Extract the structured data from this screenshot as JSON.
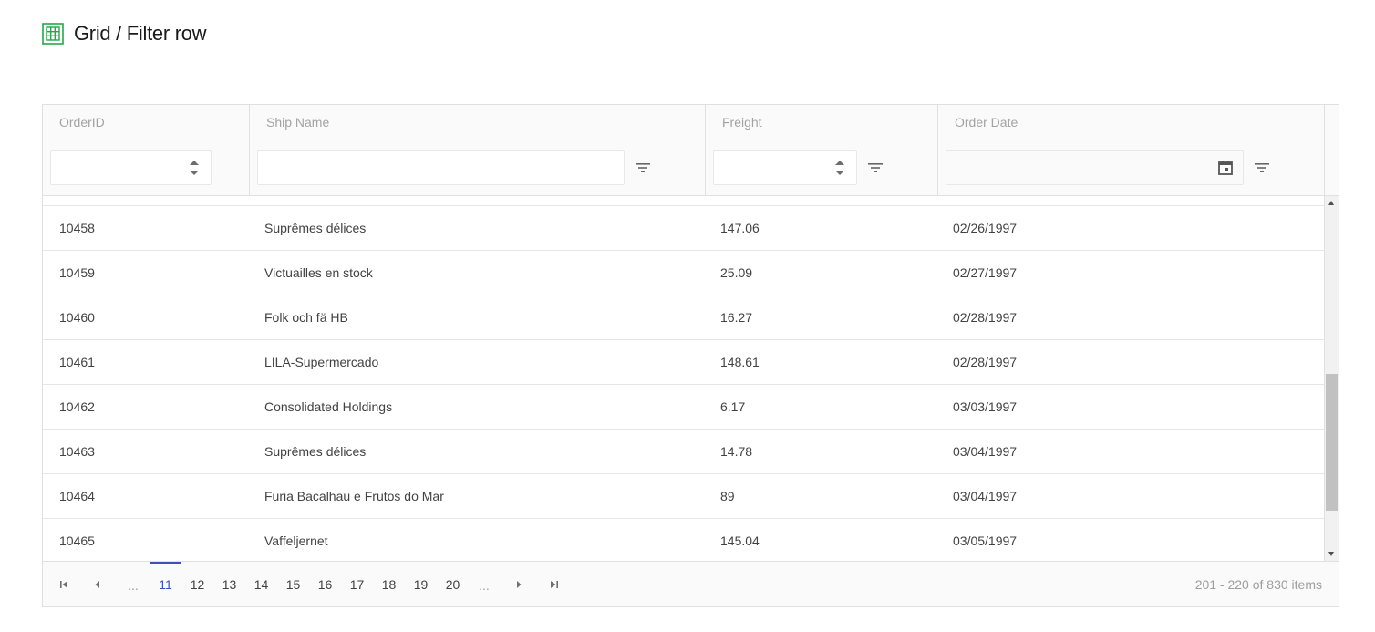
{
  "page": {
    "title": "Grid / Filter row",
    "icon": "grid-icon",
    "accent_color": "#22a84a"
  },
  "grid": {
    "columns": [
      "OrderID",
      "Ship Name",
      "Freight",
      "Order Date"
    ],
    "filters": {
      "order_id": {
        "value": "",
        "placeholder": ""
      },
      "ship_name": {
        "value": "",
        "placeholder": ""
      },
      "freight": {
        "value": "",
        "placeholder": ""
      },
      "order_date": {
        "value": "",
        "placeholder": ""
      }
    },
    "rows": [
      [
        "10458",
        "Suprêmes délices",
        "147.06",
        "02/26/1997"
      ],
      [
        "10459",
        "Victuailles en stock",
        "25.09",
        "02/27/1997"
      ],
      [
        "10460",
        "Folk och fä HB",
        "16.27",
        "02/28/1997"
      ],
      [
        "10461",
        "LILA-Supermercado",
        "148.61",
        "02/28/1997"
      ],
      [
        "10462",
        "Consolidated Holdings",
        "6.17",
        "03/03/1997"
      ],
      [
        "10463",
        "Suprêmes délices",
        "14.78",
        "03/04/1997"
      ],
      [
        "10464",
        "Furia Bacalhau e Frutos do Mar",
        "89",
        "03/04/1997"
      ],
      [
        "10465",
        "Vaffeljernet",
        "145.04",
        "03/05/1997"
      ]
    ]
  },
  "pager": {
    "ellipsis": "...",
    "pages": [
      "11",
      "12",
      "13",
      "14",
      "15",
      "16",
      "17",
      "18",
      "19",
      "20"
    ],
    "current_page": "11",
    "info": "201 - 220 of 830 items",
    "accent_color": "#3f51b5"
  }
}
